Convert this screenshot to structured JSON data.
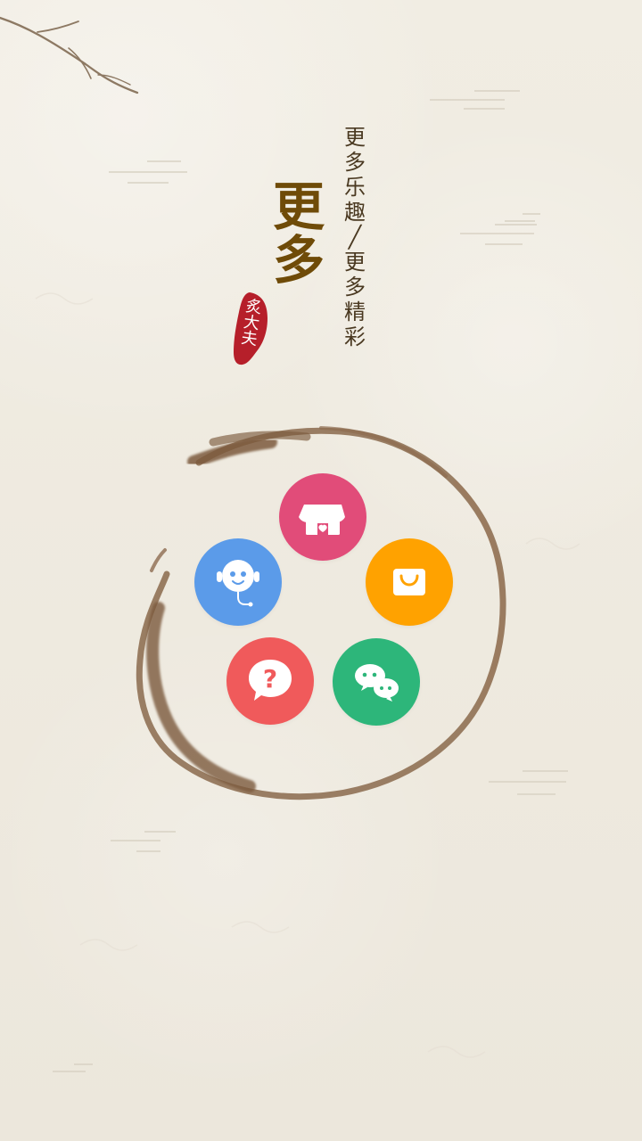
{
  "splash": {
    "title_main": "更\n多",
    "tagline": "更\n多\n乐\n趣\n╱\n更\n多\n精\n彩",
    "seal_text": "炙\n大\n夫"
  },
  "menu": {
    "items": [
      {
        "name": "store",
        "color": "#e14c79",
        "icon": "store-icon"
      },
      {
        "name": "shopping-bag",
        "color": "#ffa200",
        "icon": "shopping-bag-icon"
      },
      {
        "name": "assistant",
        "color": "#5b9be9",
        "icon": "robot-icon"
      },
      {
        "name": "help",
        "color": "#f05a5b",
        "icon": "question-icon"
      },
      {
        "name": "wechat",
        "color": "#2db67a",
        "icon": "wechat-icon"
      }
    ]
  },
  "colors": {
    "background": "#efebe0",
    "title": "#6f4b08",
    "tagline": "#4a3921",
    "seal": "#b61f2a",
    "ink": "#7a5a3c"
  }
}
